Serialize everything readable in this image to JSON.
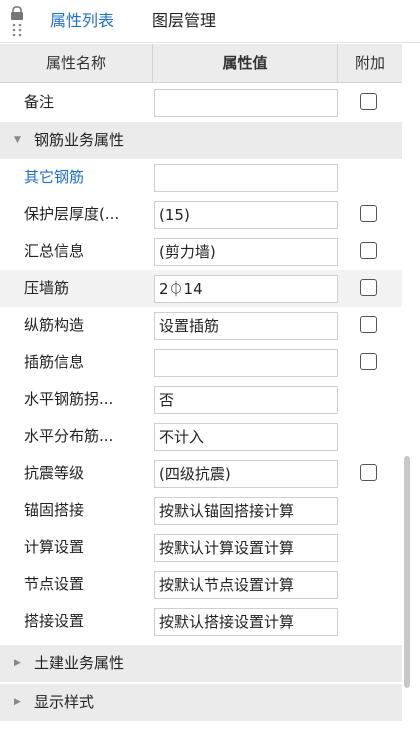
{
  "tabs": [
    {
      "label": "属性列表",
      "active": true
    },
    {
      "label": "图层管理",
      "active": false
    }
  ],
  "columns": {
    "name": "属性名称",
    "value": "属性值",
    "extra": "附加"
  },
  "row_remark": {
    "label": "备注",
    "value": "",
    "checked": false
  },
  "group_rebar": {
    "label": "钢筋业务属性",
    "expanded": true
  },
  "rows": [
    {
      "label": "其它钢筋",
      "value": "",
      "link": true
    },
    {
      "label": "保护层厚度(...",
      "value": "(15)",
      "checked": false
    },
    {
      "label": "汇总信息",
      "value": "(剪力墙)",
      "checked": false
    },
    {
      "label": "压墙筋",
      "value": "2⏀14",
      "checked": false
    },
    {
      "label": "纵筋构造",
      "value": "设置插筋",
      "checked": false
    },
    {
      "label": "插筋信息",
      "value": "",
      "checked": false
    },
    {
      "label": "水平钢筋拐...",
      "value": "否"
    },
    {
      "label": "水平分布筋...",
      "value": "不计入"
    },
    {
      "label": "抗震等级",
      "value": "(四级抗震)",
      "checked": false
    },
    {
      "label": "锚固搭接",
      "value": "按默认锚固搭接计算"
    },
    {
      "label": "计算设置",
      "value": "按默认计算设置计算"
    },
    {
      "label": "节点设置",
      "value": "按默认节点设置计算"
    },
    {
      "label": "搭接设置",
      "value": "按默认搭接设置计算"
    }
  ],
  "group_civil": {
    "label": "土建业务属性",
    "expanded": false
  },
  "group_style": {
    "label": "显示样式",
    "expanded": false
  },
  "colors": {
    "accent": "#1f6fd1",
    "header_bg": "#ececec",
    "group_bg": "#ebebeb"
  },
  "icons": [
    "lock-icon",
    "expand-triangle-icon",
    "collapse-triangle-icon"
  ]
}
